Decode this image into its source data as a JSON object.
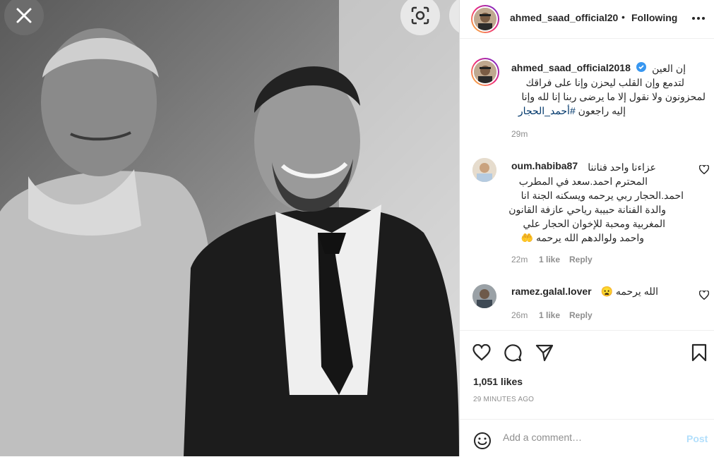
{
  "photo": {
    "alt_icon_close": "close-icon",
    "alt_icon_lens": "visual-search-icon"
  },
  "header": {
    "username": "ahmed_saad_official20",
    "separator": "•",
    "follow_label": "Following",
    "more_label": "•••"
  },
  "caption": {
    "username": "ahmed_saad_official2018",
    "lines": [
      "إن العين",
      "لتدمع وإن القلب ليحزن وإنا على فراقك",
      "لمحزونون ولا نقول إلا ما يرضى ربنا إنا لله وإنا"
    ],
    "last_line_text": "إليه راجعون ",
    "hashtag": "#أحمد_الحجار",
    "time": "29m"
  },
  "comments": [
    {
      "username": "oum.habiba87",
      "first_line": "عزاءنا واحد فناننا",
      "lines": [
        "المحترم احمد.سعد في المطرب",
        "احمد.الحجار ربي يرحمه ويسكنه الجنة انا",
        "والدة الفنانة حبيبة رياحي عازفة القانون",
        "المغربية ومحبة للإخوان الحجار علي",
        "واحمد ولوالدهم الله يرحمه 🤲"
      ],
      "time": "22m",
      "likes": "1 like",
      "reply": "Reply"
    },
    {
      "username": "ramez.galal.lover",
      "first_line": "الله يرحمه 😦",
      "lines": [],
      "time": "26m",
      "likes": "1 like",
      "reply": "Reply"
    }
  ],
  "stats": {
    "likes": "1,051 likes",
    "ago": "29 MINUTES AGO"
  },
  "comment_box": {
    "placeholder": "Add a comment…",
    "post_label": "Post"
  },
  "colors": {
    "text": "#262626",
    "muted": "#8e8e8e",
    "hashtag": "#00376b",
    "verified": "#3897f0",
    "post_disabled": "#b2dffc"
  }
}
